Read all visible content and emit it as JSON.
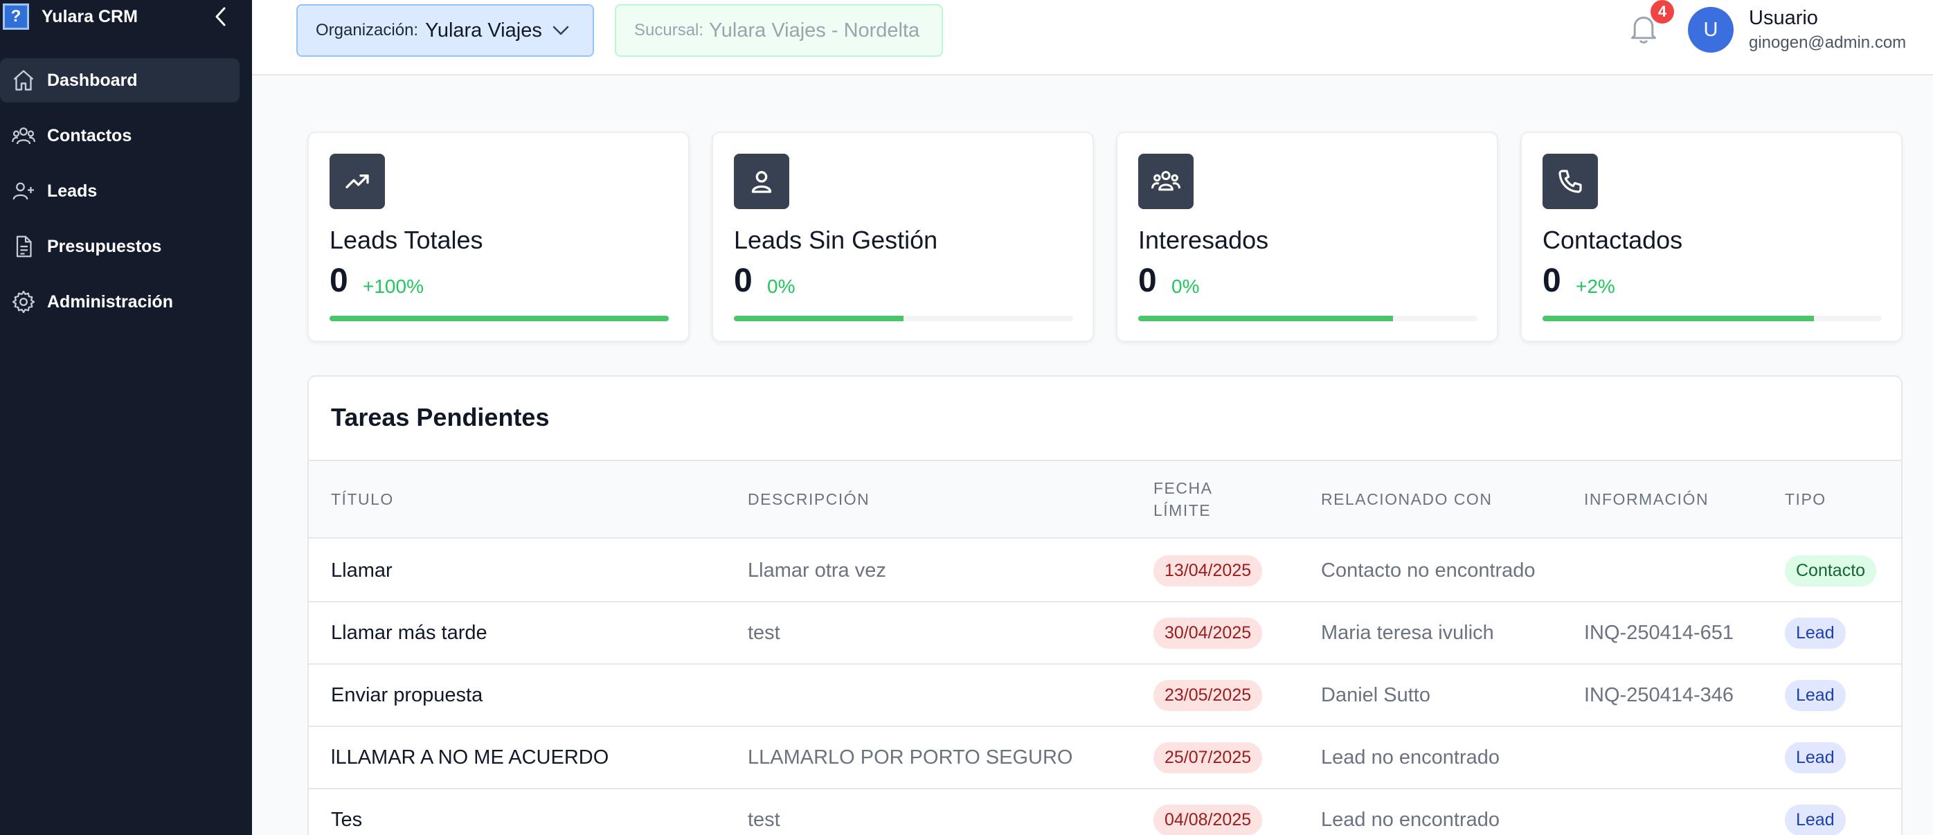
{
  "app": {
    "name": "Yulara CRM"
  },
  "sidebar": {
    "items": [
      {
        "label": "Dashboard",
        "icon": "home-icon",
        "active": true
      },
      {
        "label": "Contactos",
        "icon": "users-icon"
      },
      {
        "label": "Leads",
        "icon": "user-plus-icon"
      },
      {
        "label": "Presupuestos",
        "icon": "document-icon"
      },
      {
        "label": "Administración",
        "icon": "gear-icon"
      }
    ]
  },
  "header": {
    "org_label": "Organización:",
    "org_value": "Yulara Viajes",
    "branch_label": "Sucursal:",
    "branch_value": "Yulara Viajes - Nordelta",
    "notifications_count": "4",
    "user_initial": "U",
    "user_name": "Usuario",
    "user_email": "ginogen@admin.com"
  },
  "stats": [
    {
      "title": "Leads Totales",
      "value": "0",
      "delta": "+100%",
      "progress": 1.0,
      "icon": "trending-up-icon"
    },
    {
      "title": "Leads Sin Gestión",
      "value": "0",
      "delta": "0%",
      "progress": 0.5,
      "icon": "user-icon"
    },
    {
      "title": "Interesados",
      "value": "0",
      "delta": "0%",
      "progress": 0.75,
      "icon": "group-icon"
    },
    {
      "title": "Contactados",
      "value": "0",
      "delta": "+2%",
      "progress": 0.8,
      "icon": "phone-icon"
    }
  ],
  "tasks": {
    "title": "Tareas Pendientes",
    "headers": {
      "titulo": "TÍTULO",
      "descripcion": "DESCRIPCIÓN",
      "fecha_1": "FECHA",
      "fecha_2": "LÍMITE",
      "relacionado": "RELACIONADO CON",
      "informacion": "INFORMACIÓN",
      "tipo": "TIPO"
    },
    "rows": [
      {
        "titulo": "Llamar",
        "descripcion": "Llamar otra vez",
        "fecha": "13/04/2025",
        "relacionado": "Contacto no encontrado",
        "informacion": "",
        "tipo": "Contacto"
      },
      {
        "titulo": "Llamar más tarde",
        "descripcion": "test",
        "fecha": "30/04/2025",
        "relacionado": "Maria teresa ivulich",
        "informacion": "INQ-250414-651",
        "tipo": "Lead"
      },
      {
        "titulo": "Enviar propuesta",
        "descripcion": "",
        "fecha": "23/05/2025",
        "relacionado": "Daniel Sutto",
        "informacion": "INQ-250414-346",
        "tipo": "Lead"
      },
      {
        "titulo": "lLLAMAR A NO ME ACUERDO",
        "descripcion": "LLAMARLO POR PORTO SEGURO",
        "fecha": "25/07/2025",
        "relacionado": "Lead no encontrado",
        "informacion": "",
        "tipo": "Lead"
      },
      {
        "titulo": "Tes",
        "descripcion": "test",
        "fecha": "04/08/2025",
        "relacionado": "Lead no encontrado",
        "informacion": "",
        "tipo": "Lead"
      }
    ]
  },
  "colors": {
    "sidebar_bg": "#141b2b",
    "accent_green": "#4cc46a",
    "badge_red": "#ef4444",
    "avatar_blue": "#3b6fe0"
  }
}
